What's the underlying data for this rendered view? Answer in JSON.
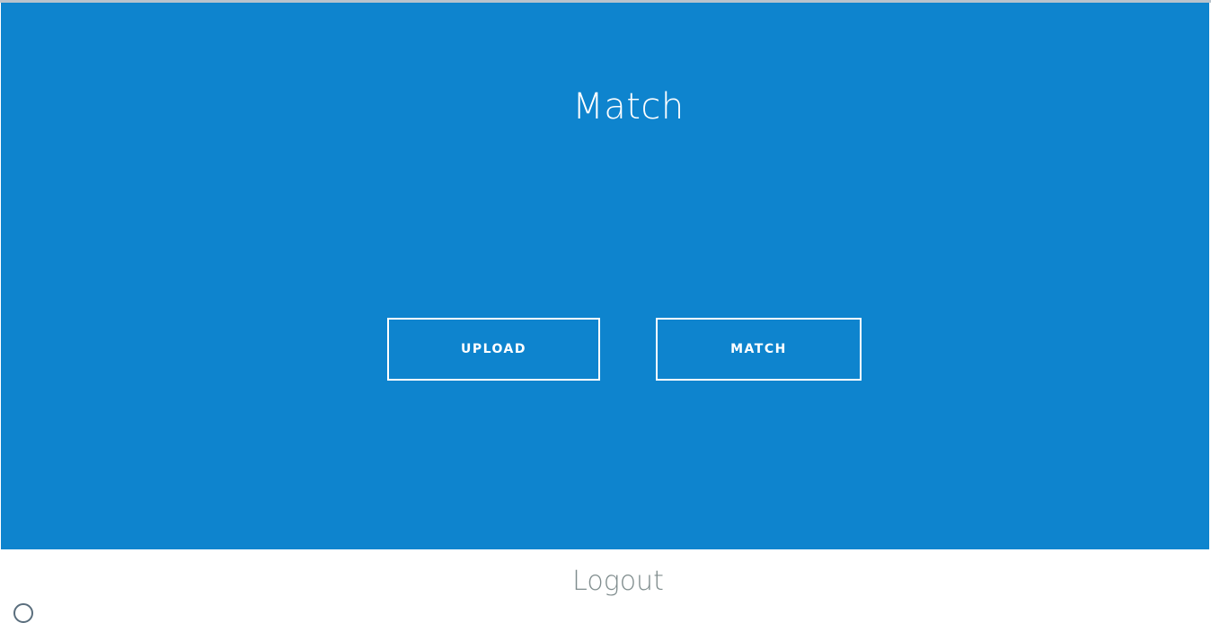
{
  "hero": {
    "title": "Match",
    "background_color": "#0e84ce"
  },
  "actions": {
    "upload_label": "UPLOAD",
    "match_label": "MATCH"
  },
  "footer": {
    "logout_label": "Logout"
  }
}
